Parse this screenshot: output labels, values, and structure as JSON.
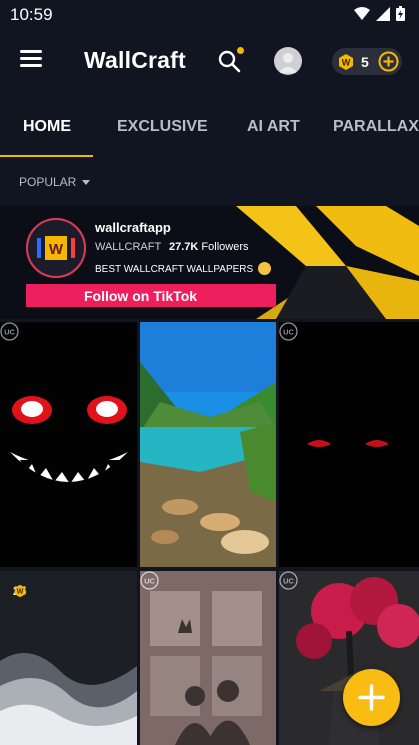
{
  "status_bar": {
    "time": "10:59"
  },
  "app_bar": {
    "title": "WallCraft",
    "coins": "5"
  },
  "tabs": [
    {
      "label": "HOME",
      "active": true
    },
    {
      "label": "EXCLUSIVE",
      "active": false
    },
    {
      "label": "AI ART",
      "active": false
    },
    {
      "label": "PARALLAX",
      "active": false
    }
  ],
  "sort": {
    "label": "POPULAR"
  },
  "ad": {
    "account_name": "wallcraftapp",
    "brand": "WALLCRAFT",
    "followers_count": "27.7K",
    "followers_label": "Followers",
    "tagline": "BEST WALLCRAFT WALLPAPERS",
    "cta_label": "Follow on TikTok"
  },
  "grid": {
    "badge_text": "UC",
    "tiles": [
      {
        "name": "smiling-demon",
        "badge": "uc"
      },
      {
        "name": "mountain-lake",
        "badge": "none"
      },
      {
        "name": "red-eyes-dark",
        "badge": "uc"
      },
      {
        "name": "ocean-waves",
        "badge": "coin",
        "price": "25"
      },
      {
        "name": "couple-silhouette-cat",
        "badge": "uc"
      },
      {
        "name": "samurai-sakura",
        "badge": "uc"
      }
    ]
  },
  "colors": {
    "background": "#101521",
    "accent": "#f5b800",
    "tiktok_pink": "#ee1f5d",
    "fab": "#f9bc12"
  },
  "icons": [
    "menu-icon",
    "search-icon",
    "avatar-icon",
    "coin-icon",
    "plus-circle-icon",
    "chevron-down-icon",
    "uc-badge-icon",
    "plus-icon"
  ]
}
